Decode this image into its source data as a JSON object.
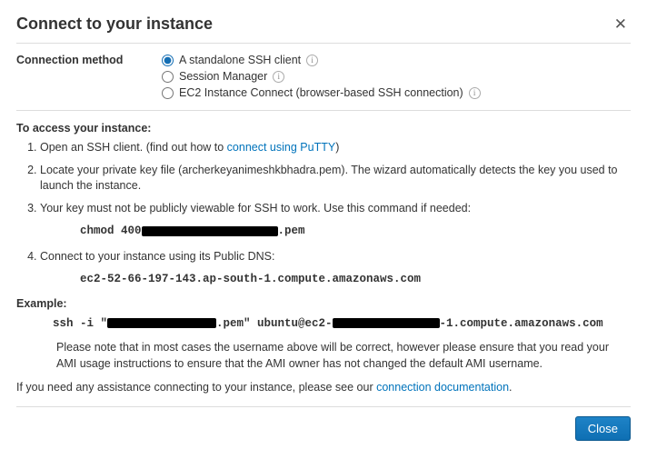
{
  "header": {
    "title": "Connect to your instance"
  },
  "method": {
    "label": "Connection method",
    "options": [
      {
        "label": "A standalone SSH client",
        "checked": true
      },
      {
        "label": "Session Manager",
        "checked": false
      },
      {
        "label": "EC2 Instance Connect (browser-based SSH connection)",
        "checked": false
      }
    ]
  },
  "access": {
    "heading": "To access your instance:",
    "step1_prefix": "Open an SSH client. (find out how to ",
    "step1_link": "connect using PuTTY",
    "step1_suffix": ")",
    "step2": "Locate your private key file (archerkeyanimeshkbhadra.pem). The wizard automatically detects the key you used to launch the instance.",
    "step3": "Your key must not be publicly viewable for SSH to work. Use this command if needed:",
    "chmod_pre": "chmod 400 ",
    "chmod_post": ".pem",
    "step4": "Connect to your instance using its Public DNS:",
    "dns": "ec2-52-66-197-143.ap-south-1.compute.amazonaws.com"
  },
  "example": {
    "heading": "Example:",
    "ssh_pre": "ssh -i \"",
    "ssh_mid": ".pem\" ubuntu@ec2-",
    "ssh_post": "-1.compute.amazonaws.com",
    "note": "Please note that in most cases the username above will be correct, however please ensure that you read your AMI usage instructions to ensure that the AMI owner has not changed the default AMI username."
  },
  "assist": {
    "prefix": "If you need any assistance connecting to your instance, please see our ",
    "link": "connection documentation",
    "suffix": "."
  },
  "footer": {
    "close": "Close"
  }
}
